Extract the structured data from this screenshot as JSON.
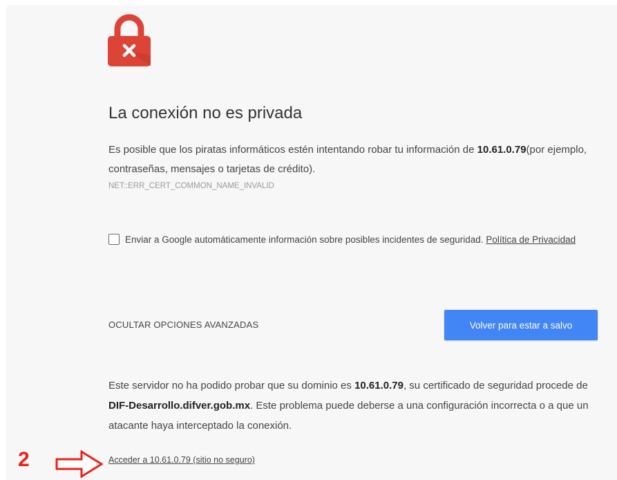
{
  "page": {
    "title": "La conexión no es privada",
    "description_prefix": "Es posible que los piratas informáticos estén intentando robar tu información de ",
    "host": "10.61.0.79",
    "description_suffix": "(por ejemplo, contraseñas, mensajes o tarjetas de crédito).",
    "error_code": "NET::ERR_CERT_COMMON_NAME_INVALID"
  },
  "report": {
    "checked": false,
    "text": "Enviar a Google automáticamente información sobre posibles incidentes de seguridad. ",
    "privacy_link": "Política de Privacidad"
  },
  "actions": {
    "advanced_label": "OCULTAR OPCIONES AVANZADAS",
    "safe_button": "Volver para estar a salvo"
  },
  "details": {
    "part1": "Este servidor no ha podido probar que su dominio es ",
    "domain": "10.61.0.79",
    "part2": ", su certificado de seguridad procede de ",
    "issuer": "DIF-Desarrollo.difver.gob.mx",
    "part3": ". Este problema puede deberse a una configuración incorrecta o a que un atacante haya interceptado la conexión.",
    "proceed_link": "Acceder a 10.61.0.79 (sitio no seguro)"
  },
  "annotation": {
    "number": "2",
    "color": "#e8231a"
  },
  "colors": {
    "accent": "#4285f4",
    "lock": "#db4437",
    "background": "#f7f7f7"
  },
  "icons": {
    "lock": "lock-error-icon",
    "arrow": "arrow-right-outline-icon"
  }
}
